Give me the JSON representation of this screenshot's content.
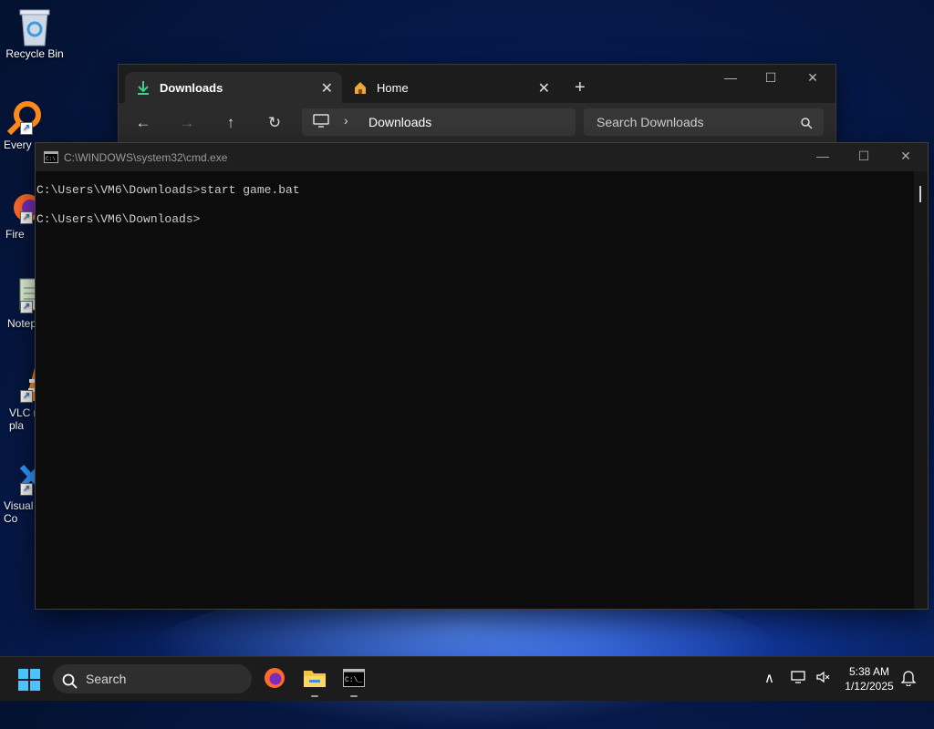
{
  "desktop": {
    "icons": [
      {
        "label": "Recycle Bin",
        "icon": "recycle-bin-icon"
      },
      {
        "label": "Every",
        "icon": "everything-search-icon"
      },
      {
        "label": "Fire",
        "icon": "firefox-icon"
      },
      {
        "label": "Notep",
        "icon": "notepad-icon"
      },
      {
        "label": "VLC r\npla",
        "icon": "vlc-icon"
      },
      {
        "label": "Visual\nCo",
        "icon": "vscode-icon"
      }
    ]
  },
  "explorer": {
    "tabs": [
      {
        "label": "Downloads",
        "icon": "download-icon",
        "active": true
      },
      {
        "label": "Home",
        "icon": "home-icon",
        "active": false
      }
    ],
    "new_tab": "+",
    "breadcrumb": "Downloads",
    "search_placeholder": "Search Downloads"
  },
  "cmd": {
    "title": "C:\\WINDOWS\\system32\\cmd.exe",
    "lines": [
      "C:\\Users\\VM6\\Downloads>start game.bat",
      "",
      "C:\\Users\\VM6\\Downloads>"
    ]
  },
  "taskbar": {
    "search_label": "Search",
    "time": "5:38 AM",
    "date": "1/12/2025"
  },
  "colors": {
    "accent": "#2f6cff",
    "download_green": "#3fcf8e",
    "home_orange": "#f2a33a"
  }
}
